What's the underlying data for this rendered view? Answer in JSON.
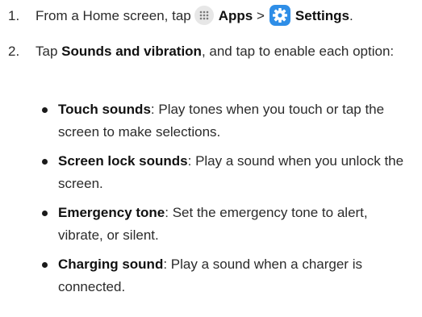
{
  "steps": [
    {
      "number": "1.",
      "prefix": "From a Home screen, tap",
      "apps_label": "Apps",
      "separator": ">",
      "settings_label": "Settings",
      "suffix": "."
    },
    {
      "number": "2.",
      "prefix": "Tap",
      "bold": "Sounds and vibration",
      "suffix": ", and tap to enable each option:"
    }
  ],
  "options": [
    {
      "title": "Touch sounds",
      "description": ": Play tones when you touch or tap the screen to make selections."
    },
    {
      "title": "Screen lock sounds",
      "description": ": Play a sound when you unlock the screen."
    },
    {
      "title": "Emergency tone",
      "description": ": Set the emergency tone to alert, vibrate, or silent."
    },
    {
      "title": "Charging sound",
      "description": ": Play a sound when a charger is connected."
    }
  ],
  "icons": {
    "apps": "apps-grid-icon",
    "settings": "settings-gear-icon"
  },
  "colors": {
    "text": "#2b2b2b",
    "settings_icon_bg": "#2f8ee7",
    "apps_icon_bg": "#e7e7e7"
  }
}
